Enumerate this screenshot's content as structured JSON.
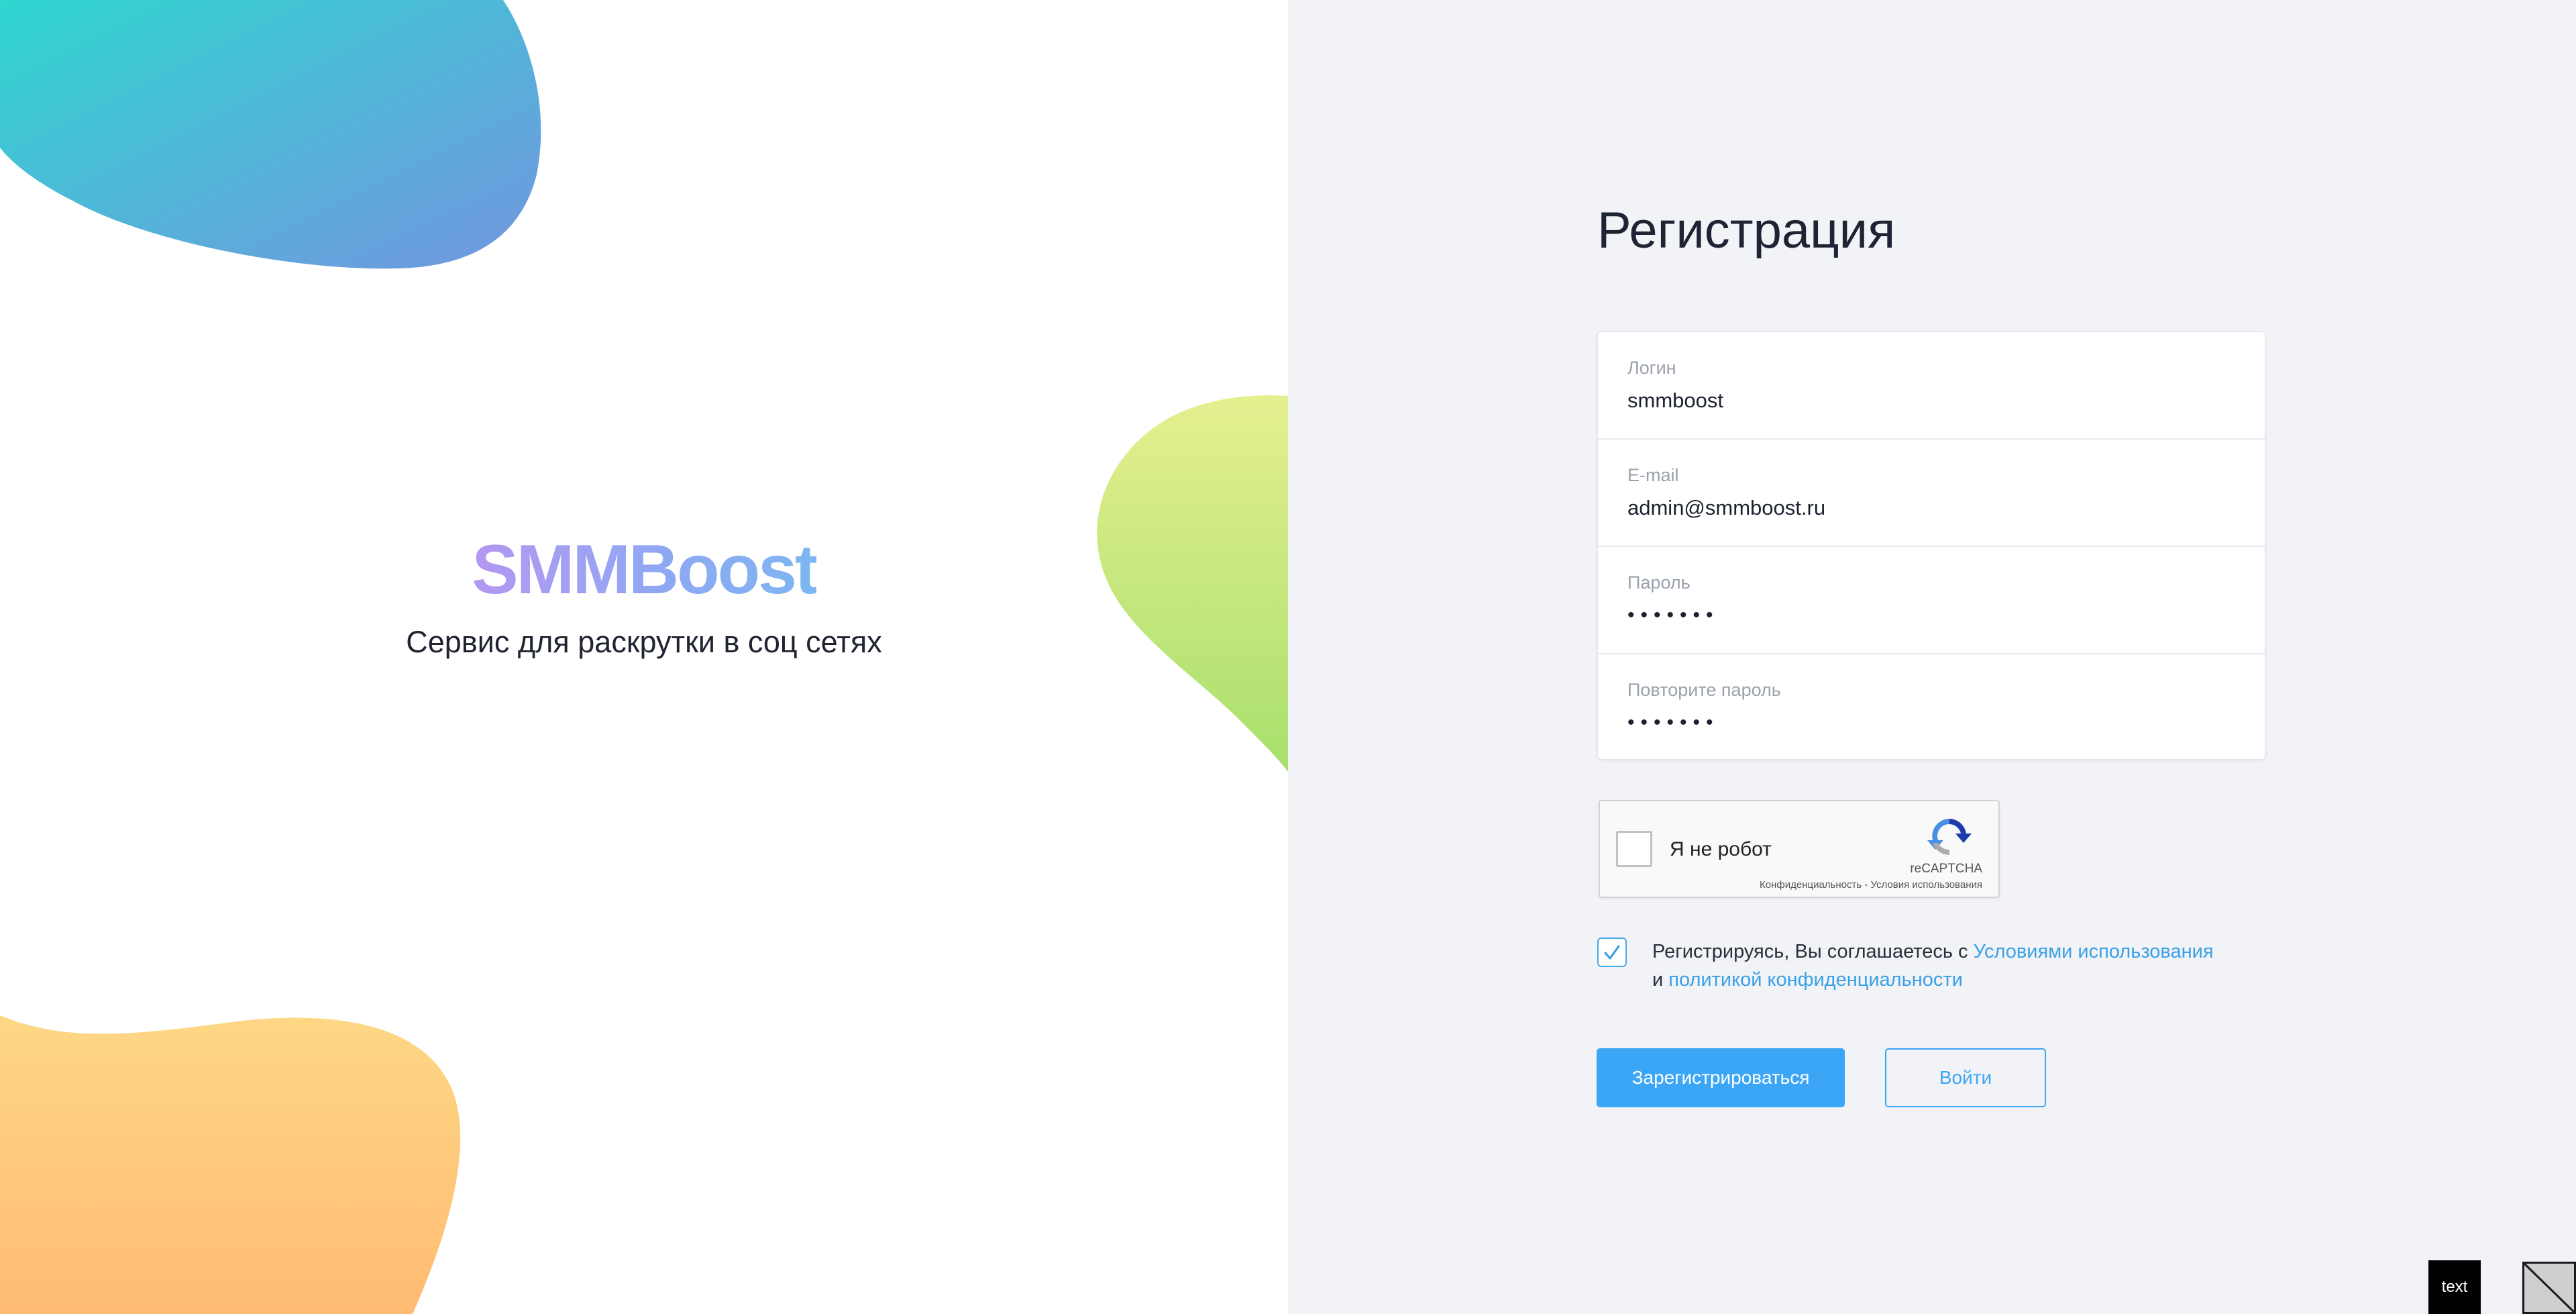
{
  "brand": {
    "logo_text": "SMMBoost",
    "tagline": "Сервис для раскрутки в соц сетях"
  },
  "form": {
    "title": "Регистрация",
    "fields": [
      {
        "label": "Логин",
        "value": "smmboost"
      },
      {
        "label": "E-mail",
        "value": "admin@smmboost.ru"
      },
      {
        "label": "Пароль",
        "value": "•••••••"
      },
      {
        "label": "Повторите пароль",
        "value": "•••••••"
      }
    ]
  },
  "captcha": {
    "label": "Я не робот",
    "brand": "reCAPTCHA",
    "links": "Конфиденциальность - Условия использования",
    "checked": false
  },
  "agreement": {
    "checked": true,
    "text_before": "Регистрируясь, Вы соглашаетесь с ",
    "terms_link": "Условиями использования",
    "text_and": "и ",
    "privacy_link": "политикой конфиденциальности"
  },
  "buttons": {
    "register": "Зарегистрироваться",
    "login": "Войти"
  },
  "corner_badge": "text",
  "colors": {
    "accent": "#3ba6f5",
    "right_background": "#f2f3f7",
    "link": "#3aa0e6"
  }
}
